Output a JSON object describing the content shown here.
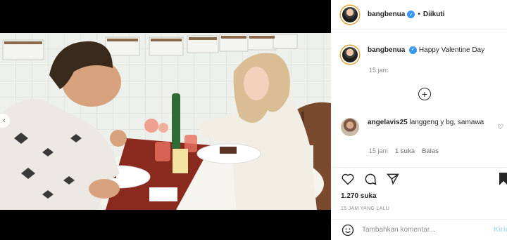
{
  "post": {
    "username": "bangbenua",
    "follow_status": "Diikuti",
    "caption": "Happy Valentine Day ",
    "caption_time": "15 jam"
  },
  "comment": {
    "username": "angelavis25",
    "text": "langgeng y bg, samawa",
    "time": "15 jam",
    "likes": "1 suka",
    "reply": "Balas"
  },
  "actions": {
    "likes": "1.270 suka",
    "posted": "15 JAM YANG LALU"
  },
  "add_comment": {
    "placeholder": "Tambahkan komentar...",
    "post_label": "Kirim"
  },
  "colors": {
    "verified": "#3897f0",
    "post_button": "#b2dffc",
    "meta_text": "#8e8e8e"
  },
  "icons": [
    "verified-icon",
    "plus-circle-icon",
    "heart-icon",
    "comment-icon",
    "share-icon",
    "bookmark-icon",
    "smile-icon",
    "chevron-left-icon"
  ]
}
